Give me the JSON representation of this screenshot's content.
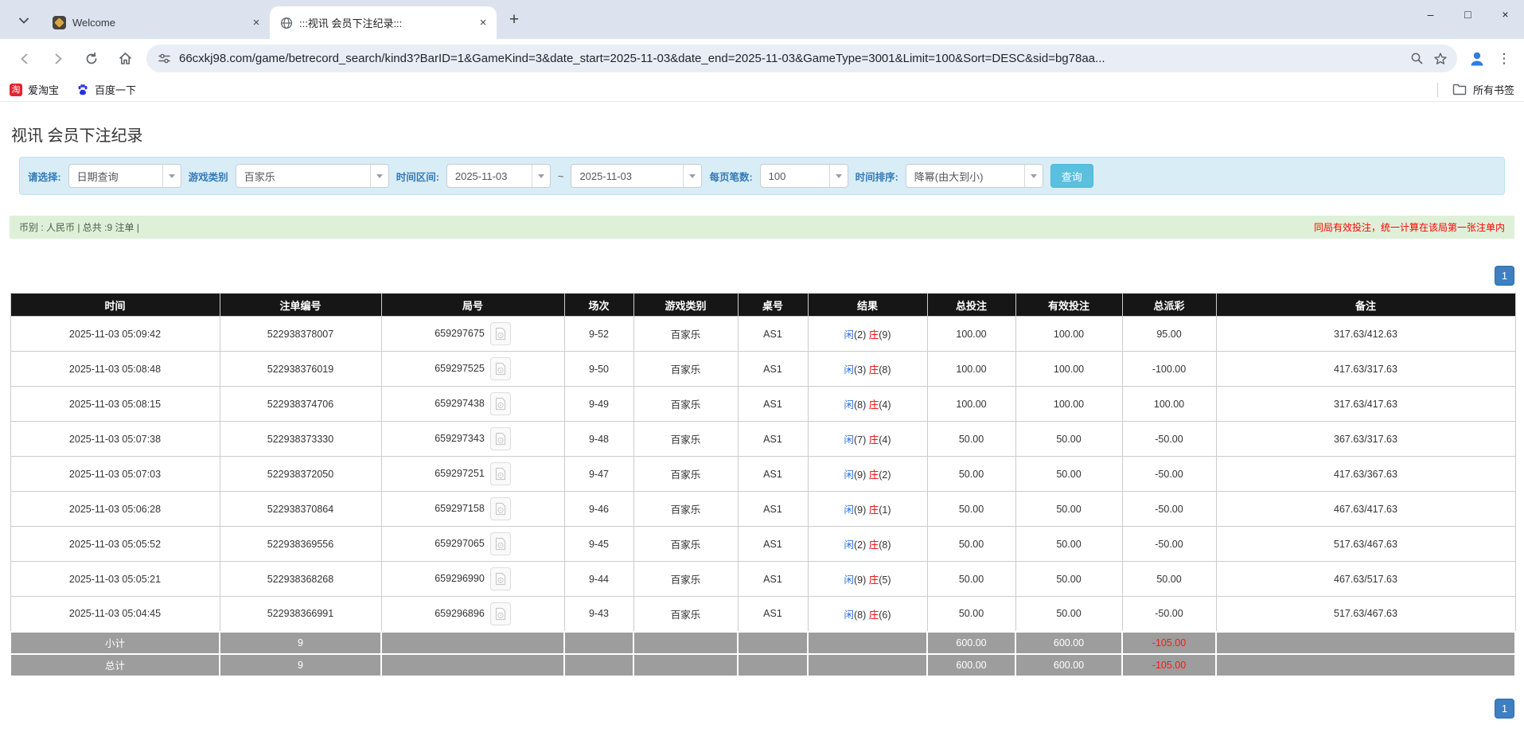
{
  "browser": {
    "tabs": [
      {
        "title": "Welcome"
      },
      {
        "title": ":::视讯 会员下注纪录:::"
      }
    ],
    "url": "66cxkj98.com/game/betrecord_search/kind3?BarID=1&GameKind=3&date_start=2025-11-03&date_end=2025-11-03&GameType=3001&Limit=100&Sort=DESC&sid=bg78aa...",
    "bookmarks": [
      {
        "label": "爱淘宝"
      },
      {
        "label": "百度一下"
      }
    ],
    "all_bookmarks_label": "所有书签"
  },
  "glyphs": {
    "close": "×",
    "new_tab": "+",
    "minimize": "–",
    "maximize": "□",
    "kebab": "⋮",
    "taobao_char": "淘"
  },
  "page": {
    "title": "视讯 会员下注纪录",
    "filters": {
      "select_label": "请选择:",
      "select_value": "日期查询",
      "game_type_label": "游戏类别",
      "game_type_value": "百家乐",
      "date_range_label": "时间区间:",
      "date_start": "2025-11-03",
      "tilde": "~",
      "date_end": "2025-11-03",
      "page_size_label": "每页笔数:",
      "page_size_value": "100",
      "sort_label": "时间排序:",
      "sort_value": "降幂(由大到小)",
      "search_button": "查询"
    },
    "summary": {
      "left": "币别 : 人民币 | 总共 :9 注单 |",
      "right": "同局有效投注，统一计算在该局第一张注单内"
    },
    "pagination": {
      "page": "1"
    },
    "table": {
      "headers": [
        "时间",
        "注单编号",
        "局号",
        "场次",
        "游戏类别",
        "桌号",
        "结果",
        "总投注",
        "有效投注",
        "总派彩",
        "备注"
      ],
      "result_player_label": "闲",
      "result_banker_label": "庄",
      "rows": [
        {
          "time": "2025-11-03 05:09:42",
          "bet_id": "522938378007",
          "round_id": "659297675",
          "session": "9-52",
          "game": "百家乐",
          "table_no": "AS1",
          "player": "2",
          "banker": "9",
          "total_bet": "100.00",
          "valid_bet": "100.00",
          "payout": "95.00",
          "note": "317.63/412.63"
        },
        {
          "time": "2025-11-03 05:08:48",
          "bet_id": "522938376019",
          "round_id": "659297525",
          "session": "9-50",
          "game": "百家乐",
          "table_no": "AS1",
          "player": "3",
          "banker": "8",
          "total_bet": "100.00",
          "valid_bet": "100.00",
          "payout": "-100.00",
          "note": "417.63/317.63"
        },
        {
          "time": "2025-11-03 05:08:15",
          "bet_id": "522938374706",
          "round_id": "659297438",
          "session": "9-49",
          "game": "百家乐",
          "table_no": "AS1",
          "player": "8",
          "banker": "4",
          "total_bet": "100.00",
          "valid_bet": "100.00",
          "payout": "100.00",
          "note": "317.63/417.63"
        },
        {
          "time": "2025-11-03 05:07:38",
          "bet_id": "522938373330",
          "round_id": "659297343",
          "session": "9-48",
          "game": "百家乐",
          "table_no": "AS1",
          "player": "7",
          "banker": "4",
          "total_bet": "50.00",
          "valid_bet": "50.00",
          "payout": "-50.00",
          "note": "367.63/317.63"
        },
        {
          "time": "2025-11-03 05:07:03",
          "bet_id": "522938372050",
          "round_id": "659297251",
          "session": "9-47",
          "game": "百家乐",
          "table_no": "AS1",
          "player": "9",
          "banker": "2",
          "total_bet": "50.00",
          "valid_bet": "50.00",
          "payout": "-50.00",
          "note": "417.63/367.63"
        },
        {
          "time": "2025-11-03 05:06:28",
          "bet_id": "522938370864",
          "round_id": "659297158",
          "session": "9-46",
          "game": "百家乐",
          "table_no": "AS1",
          "player": "9",
          "banker": "1",
          "total_bet": "50.00",
          "valid_bet": "50.00",
          "payout": "-50.00",
          "note": "467.63/417.63"
        },
        {
          "time": "2025-11-03 05:05:52",
          "bet_id": "522938369556",
          "round_id": "659297065",
          "session": "9-45",
          "game": "百家乐",
          "table_no": "AS1",
          "player": "2",
          "banker": "8",
          "total_bet": "50.00",
          "valid_bet": "50.00",
          "payout": "-50.00",
          "note": "517.63/467.63"
        },
        {
          "time": "2025-11-03 05:05:21",
          "bet_id": "522938368268",
          "round_id": "659296990",
          "session": "9-44",
          "game": "百家乐",
          "table_no": "AS1",
          "player": "9",
          "banker": "5",
          "total_bet": "50.00",
          "valid_bet": "50.00",
          "payout": "50.00",
          "note": "467.63/517.63"
        },
        {
          "time": "2025-11-03 05:04:45",
          "bet_id": "522938366991",
          "round_id": "659296896",
          "session": "9-43",
          "game": "百家乐",
          "table_no": "AS1",
          "player": "8",
          "banker": "6",
          "total_bet": "50.00",
          "valid_bet": "50.00",
          "payout": "-50.00",
          "note": "517.63/467.63"
        }
      ],
      "subtotal": {
        "label": "小计",
        "count": "9",
        "total_bet": "600.00",
        "valid_bet": "600.00",
        "payout": "-105.00"
      },
      "total": {
        "label": "总计",
        "count": "9",
        "total_bet": "600.00",
        "valid_bet": "600.00",
        "payout": "-105.00"
      }
    }
  },
  "colors": {
    "accent_blue": "#3273d8",
    "banker_red": "#e60000",
    "negative_red": "#ff0000",
    "filter_bg": "#d9edf7",
    "success_bg": "#dff0d8",
    "header_black": "#161616",
    "footer_gray": "#9d9d9d",
    "search_button_bg": "#5bc0de",
    "pagination_blue": "#3d7fc1"
  }
}
